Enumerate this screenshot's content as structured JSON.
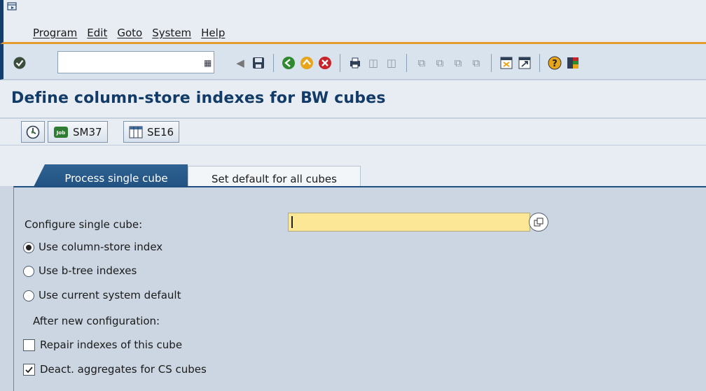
{
  "menubar": {
    "items": [
      "Program",
      "Edit",
      "Goto",
      "System",
      "Help"
    ]
  },
  "toolbar": {
    "command_field_value": ""
  },
  "title": "Define column-store indexes for BW cubes",
  "app_toolbar": {
    "buttons": [
      {
        "icon": "execute-icon",
        "label": ""
      },
      {
        "icon": "job-icon",
        "label": "SM37"
      },
      {
        "icon": "table-icon",
        "label": "SE16"
      }
    ]
  },
  "tabs": [
    {
      "label": "Process single cube",
      "active": true
    },
    {
      "label": "Set default for all cubes",
      "active": false
    }
  ],
  "form": {
    "cube_label": "Configure single cube:",
    "cube_value": "",
    "radios": [
      {
        "label": "Use column-store index",
        "selected": true
      },
      {
        "label": "Use b-tree indexes",
        "selected": false
      },
      {
        "label": "Use current system default",
        "selected": false
      }
    ],
    "after_label": "After new configuration:",
    "checkboxes": [
      {
        "label": "Repair indexes of this cube",
        "checked": false
      },
      {
        "label": "Deact. aggregates for CS cubes",
        "checked": true
      }
    ]
  },
  "colors": {
    "accent": "#123b67",
    "tab_active": "#1f4f7e",
    "input_required": "#fbe795",
    "menu_rule": "#e39a2f"
  }
}
